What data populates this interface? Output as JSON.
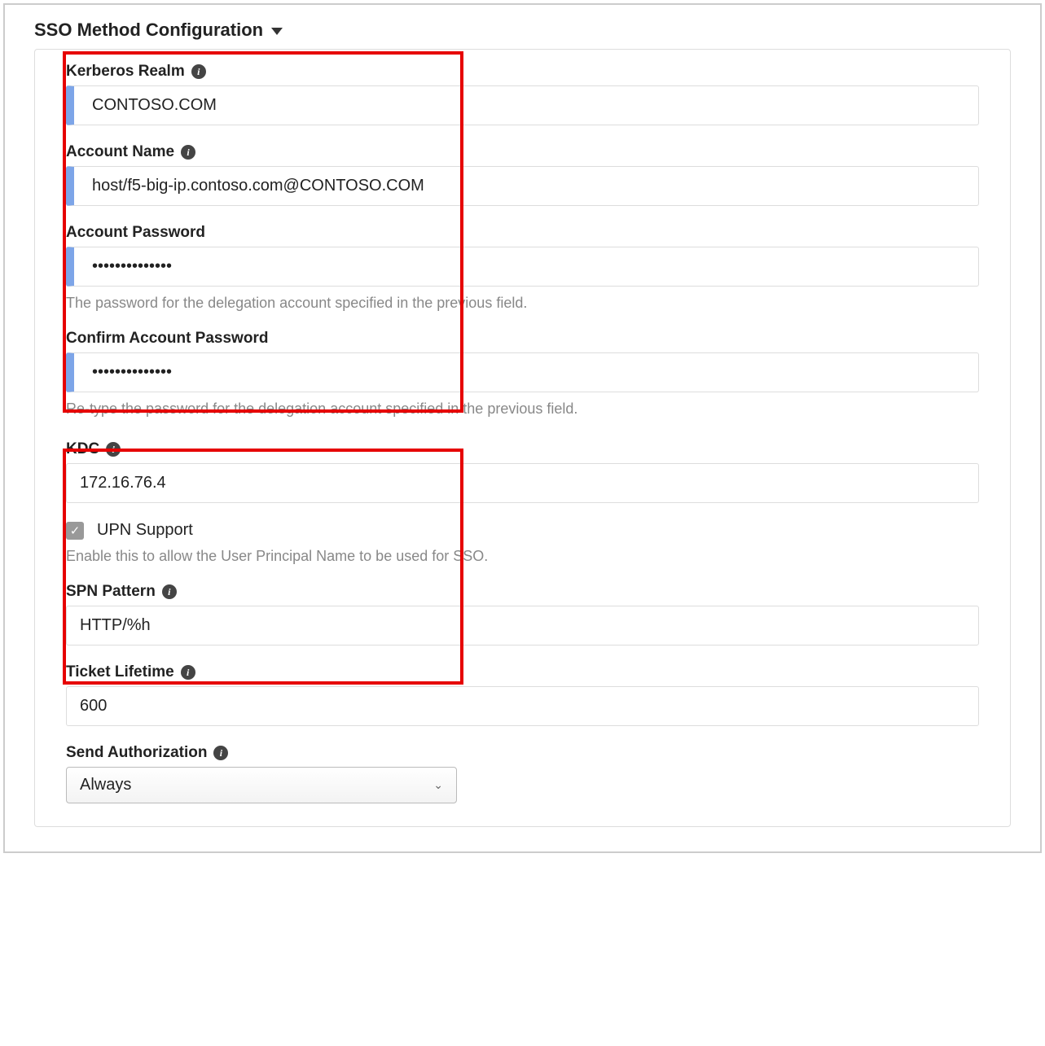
{
  "section": {
    "title": "SSO Method Configuration"
  },
  "fields": {
    "kerberos_realm": {
      "label": "Kerberos Realm",
      "value": "CONTOSO.COM"
    },
    "account_name": {
      "label": "Account Name",
      "value": "host/f5-big-ip.contoso.com@CONTOSO.COM"
    },
    "account_password": {
      "label": "Account Password",
      "value": "••••••••••••••",
      "help": "The password for the delegation account specified in the previous field."
    },
    "confirm_password": {
      "label": "Confirm Account Password",
      "value": "••••••••••••••",
      "help": "Re-type the password for the delegation account specified in the previous field."
    },
    "kdc": {
      "label": "KDC",
      "value": "172.16.76.4"
    },
    "upn": {
      "label": "UPN Support",
      "checked": true,
      "help": "Enable this to allow the User Principal Name to be used for SSO."
    },
    "spn_pattern": {
      "label": "SPN Pattern",
      "value": "HTTP/%h"
    },
    "ticket_lifetime": {
      "label": "Ticket Lifetime",
      "value": "600"
    },
    "send_auth": {
      "label": "Send Authorization",
      "value": "Always"
    }
  }
}
